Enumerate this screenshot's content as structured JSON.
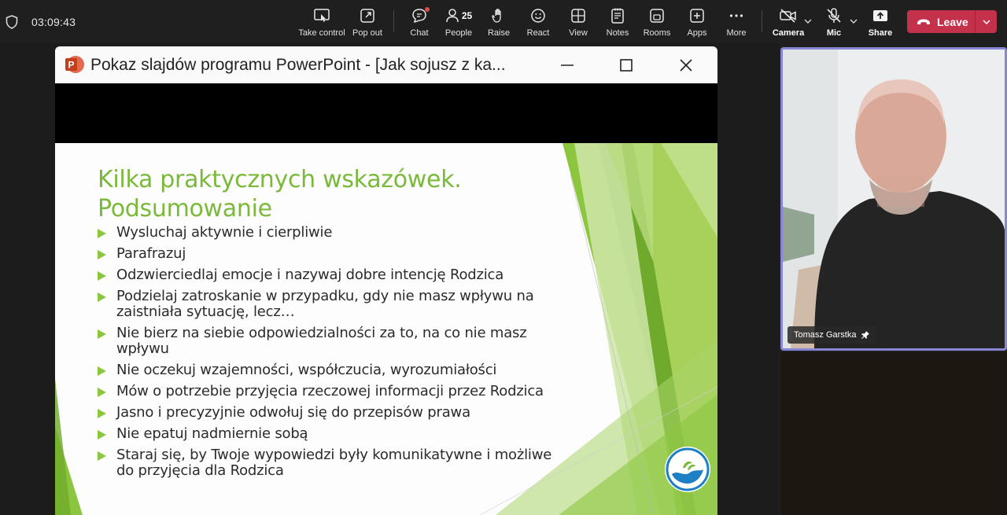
{
  "meeting": {
    "timer": "03:09:43"
  },
  "toolbar": {
    "items": [
      {
        "label": "Take control",
        "icon": "take-control-icon"
      },
      {
        "label": "Pop out",
        "icon": "pop-out-icon"
      },
      {
        "label": "Chat",
        "icon": "chat-icon"
      },
      {
        "label": "People",
        "icon": "people-icon",
        "count": "25"
      },
      {
        "label": "Raise",
        "icon": "raise-hand-icon"
      },
      {
        "label": "React",
        "icon": "react-smiley-icon"
      },
      {
        "label": "View",
        "icon": "view-grid-icon"
      },
      {
        "label": "Notes",
        "icon": "notes-icon"
      },
      {
        "label": "Rooms",
        "icon": "rooms-icon"
      },
      {
        "label": "Apps",
        "icon": "apps-icon"
      },
      {
        "label": "More",
        "icon": "more-icon"
      },
      {
        "label": "Camera",
        "icon": "camera-off-icon"
      },
      {
        "label": "Mic",
        "icon": "mic-off-icon"
      },
      {
        "label": "Share",
        "icon": "share-icon"
      }
    ],
    "leave_label": "Leave",
    "leave_color": "#c4314b"
  },
  "shared_window": {
    "title": "Pokaz slajdów programu PowerPoint - [Jak sojusz z ka...",
    "app_logo_letter": "P"
  },
  "slide": {
    "title_line1": "Kilka praktycznych wskazówek.",
    "title_line2": "Podsumowanie",
    "title_color": "#7ab93a",
    "bullets": [
      "Wysluchaj aktywnie i cierpliwie",
      "Parafrazuj",
      "Odzwierciedlaj emocje i nazywaj dobre intencję Rodzica",
      "Podzielaj zatroskanie w przypadku, gdy nie masz wpływu na zaistniała sytuację, lecz…",
      "Nie bierz na siebie odpowiedzialności za to, na co nie masz wpływu",
      "Nie oczekuj wzajemności, współczucia, wyrozumiałości",
      "Mów o potrzebie przyjęcia rzeczowej informacji przez Rodzica",
      "Jasno i precyzyjnie odwołuj się do przepisów prawa",
      "Nie epatuj nadmiernie sobą",
      "Staraj się, by Twoje wypowiedzi były komunikatywne i możliwe do przyjęcia dla Rodzica"
    ]
  },
  "participant": {
    "name": "Tomasz Garstka",
    "border_color": "#8a86d6"
  }
}
